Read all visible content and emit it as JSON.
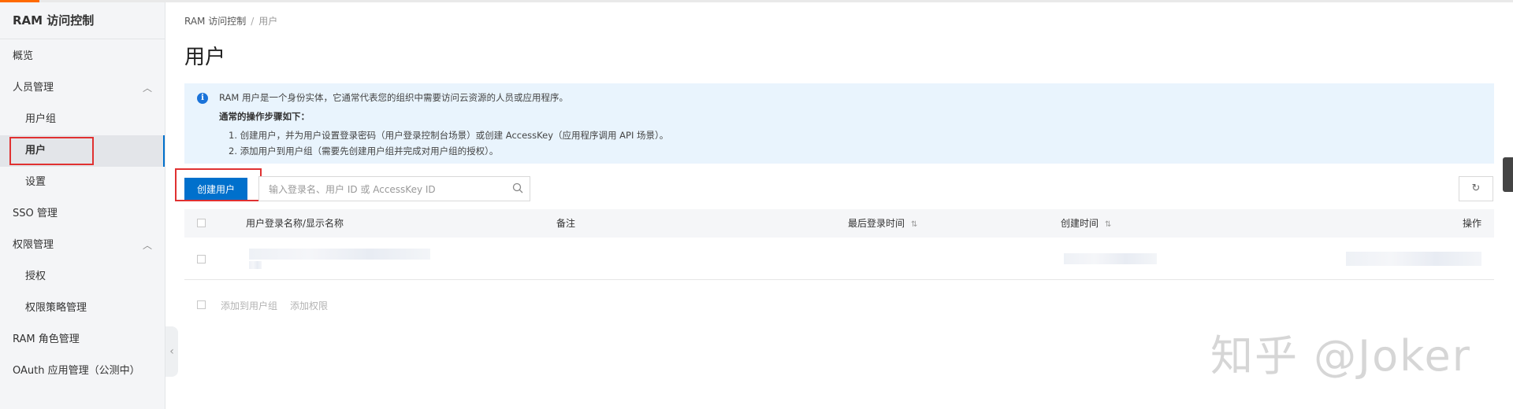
{
  "sidebar": {
    "title": "RAM 访问控制",
    "items": [
      {
        "label": "概览"
      },
      {
        "label": "人员管理"
      },
      {
        "label": "用户组"
      },
      {
        "label": "用户"
      },
      {
        "label": "设置"
      },
      {
        "label": "SSO 管理"
      },
      {
        "label": "权限管理"
      },
      {
        "label": "授权"
      },
      {
        "label": "权限策略管理"
      },
      {
        "label": "RAM 角色管理"
      },
      {
        "label": "OAuth 应用管理（公测中）"
      }
    ],
    "active_item": "用户"
  },
  "breadcrumb": {
    "root": "RAM 访问控制",
    "separator": "/",
    "current": "用户"
  },
  "page_title": "用户",
  "notice": {
    "intro": "RAM 用户是一个身份实体，它通常代表您的组织中需要访问云资源的人员或应用程序。",
    "steps_title": "通常的操作步骤如下：",
    "step1": "1. 创建用户，并为用户设置登录密码（用户登录控制台场景）或创建 AccessKey（应用程序调用 API 场景）。",
    "step2": "2. 添加用户到用户组（需要先创建用户组并完成对用户组的授权）。"
  },
  "toolbar": {
    "create_label": "创建用户",
    "search_placeholder": "输入登录名、用户 ID 或 AccessKey ID"
  },
  "table": {
    "columns": [
      "用户登录名称/显示名称",
      "备注",
      "最后登录时间",
      "创建时间",
      "操作"
    ],
    "rows_redacted": 1
  },
  "footer": {
    "add_to_group": "添加到用户组",
    "add_permission": "添加权限"
  },
  "watermark": "知乎 @Joker",
  "colors": {
    "accent": "#ff6a00",
    "primary": "#0070cc",
    "highlight": "#e03131",
    "notice_bg": "#e9f4fd"
  }
}
